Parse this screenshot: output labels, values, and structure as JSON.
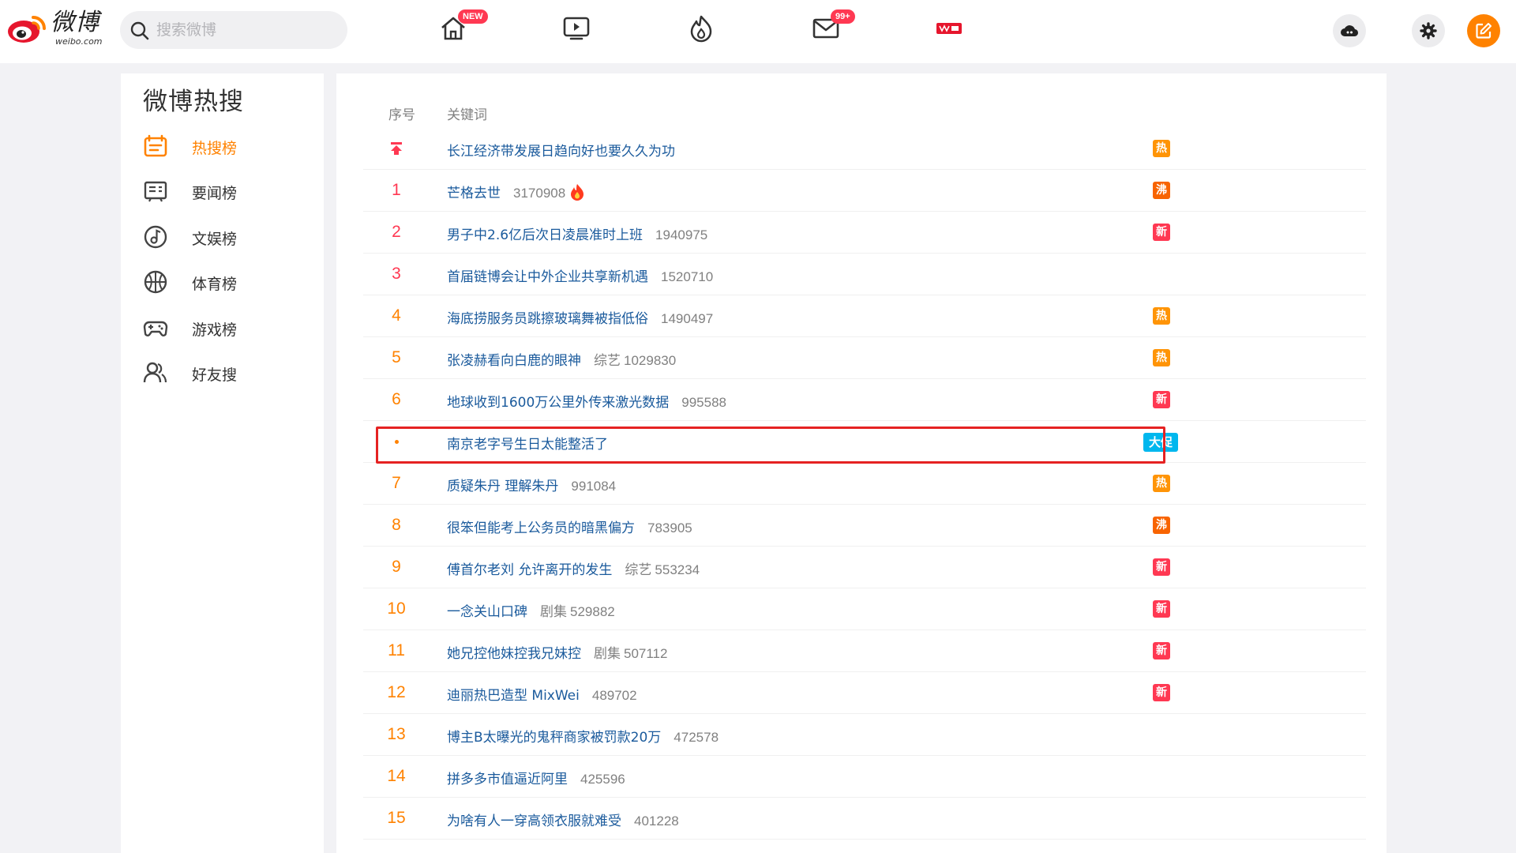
{
  "header": {
    "logo_text": "微博",
    "logo_sub": "weibo.com",
    "search_placeholder": "搜索微博",
    "nav": [
      {
        "name": "home",
        "badge": "NEW"
      },
      {
        "name": "video",
        "badge": ""
      },
      {
        "name": "hot",
        "badge": ""
      },
      {
        "name": "messages",
        "badge": "99+"
      },
      {
        "name": "weibo-live",
        "badge": ""
      }
    ],
    "icons": [
      "cloud-icon",
      "gear-icon",
      "compose-icon"
    ],
    "colors": {
      "brand": "#ff8200",
      "badge": "#ff3852"
    }
  },
  "sidebar": {
    "title": "微博热搜",
    "items": [
      {
        "label": "热搜榜",
        "icon": "hot-list-icon",
        "active": true
      },
      {
        "label": "要闻榜",
        "icon": "news-icon",
        "active": false
      },
      {
        "label": "文娱榜",
        "icon": "music-icon",
        "active": false
      },
      {
        "label": "体育榜",
        "icon": "basketball-icon",
        "active": false
      },
      {
        "label": "游戏榜",
        "icon": "gamepad-icon",
        "active": false
      },
      {
        "label": "好友搜",
        "icon": "friends-icon",
        "active": false
      }
    ]
  },
  "list": {
    "headers": {
      "rank": "序号",
      "keyword": "关键词"
    },
    "rows": [
      {
        "rank": "",
        "pinned": true,
        "keyword": "长江经济带发展日趋向好也要久久为功",
        "category": "",
        "count": "",
        "tag": "热",
        "tag_type": "hot"
      },
      {
        "rank": "1",
        "keyword": "芒格去世",
        "category": "",
        "count": "3170908",
        "fire": true,
        "tag": "沸",
        "tag_type": "boil"
      },
      {
        "rank": "2",
        "keyword": "男子中2.6亿后次日凌晨准时上班",
        "category": "",
        "count": "1940975",
        "tag": "新",
        "tag_type": "new"
      },
      {
        "rank": "3",
        "keyword": "首届链博会让中外企业共享新机遇",
        "category": "",
        "count": "1520710",
        "tag": "",
        "tag_type": ""
      },
      {
        "rank": "4",
        "keyword": "海底捞服务员跳擦玻璃舞被指低俗",
        "category": "",
        "count": "1490497",
        "tag": "热",
        "tag_type": "hot"
      },
      {
        "rank": "5",
        "keyword": "张凌赫看向白鹿的眼神",
        "category": "综艺",
        "count": "1029830",
        "tag": "热",
        "tag_type": "hot"
      },
      {
        "rank": "6",
        "keyword": "地球收到1600万公里外传来激光数据",
        "category": "",
        "count": "995588",
        "tag": "新",
        "tag_type": "new"
      },
      {
        "rank": "",
        "ad": true,
        "keyword": "南京老字号生日太能整活了",
        "category": "",
        "count": "",
        "tag": "大促",
        "tag_type": "promo"
      },
      {
        "rank": "7",
        "keyword": "质疑朱丹 理解朱丹",
        "category": "",
        "count": "991084",
        "tag": "热",
        "tag_type": "hot"
      },
      {
        "rank": "8",
        "keyword": "很笨但能考上公务员的暗黑偏方",
        "category": "",
        "count": "783905",
        "tag": "沸",
        "tag_type": "boil"
      },
      {
        "rank": "9",
        "keyword": "傅首尔老刘 允许离开的发生",
        "category": "综艺",
        "count": "553234",
        "tag": "新",
        "tag_type": "new"
      },
      {
        "rank": "10",
        "keyword": "一念关山口碑",
        "category": "剧集",
        "count": "529882",
        "tag": "新",
        "tag_type": "new"
      },
      {
        "rank": "11",
        "keyword": "她兄控他妹控我兄妹控",
        "category": "剧集",
        "count": "507112",
        "tag": "新",
        "tag_type": "new"
      },
      {
        "rank": "12",
        "keyword": "迪丽热巴造型 MixWei",
        "category": "",
        "count": "489702",
        "tag": "新",
        "tag_type": "new"
      },
      {
        "rank": "13",
        "keyword": "博主B太曝光的鬼秤商家被罚款20万",
        "category": "",
        "count": "472578",
        "tag": "",
        "tag_type": ""
      },
      {
        "rank": "14",
        "keyword": "拼多多市值逼近阿里",
        "category": "",
        "count": "425596",
        "tag": "",
        "tag_type": ""
      },
      {
        "rank": "15",
        "keyword": "为啥有人一穿高领衣服就难受",
        "category": "",
        "count": "401228",
        "tag": "",
        "tag_type": ""
      }
    ]
  }
}
